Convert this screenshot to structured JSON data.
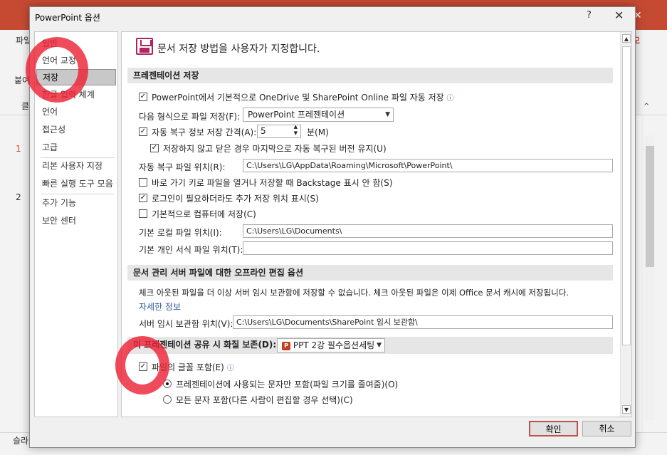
{
  "background": {
    "ribbon_tab": "파일",
    "paste_label": "붙여",
    "clipboard_label": "클",
    "auto_label": "자동",
    "slide_1": "1",
    "slide_2": "2",
    "status_text": "슬라",
    "corner_tab": "모",
    "close_glyph": "✕"
  },
  "dialog": {
    "title": "PowerPoint 옵션",
    "help": "?",
    "close": "✕",
    "nav_items": [
      "일반",
      "언어 교정",
      "저장",
      "한글 입력 체계",
      "언어",
      "접근성",
      "고급",
      "리본 사용자 지정",
      "빠른 실행 도구 모음",
      "추가 기능",
      "보안 센터"
    ],
    "selected_nav": "저장",
    "header": "문서 저장 방법을 사용자가 지정합니다.",
    "sections": {
      "presentation_save": {
        "title": "프레젠테이션 저장",
        "autosave_cloud": "PowerPoint에서 기본적으로 OneDrive 및 SharePoint Online 파일 자동 저장",
        "save_format_label": "다음 형식으로 파일 저장(F):",
        "save_format_value": "PowerPoint 프레젠테이션",
        "autorecover_label": "자동 복구 정보 저장 간격(A):",
        "autorecover_value": "5",
        "autorecover_unit": "분(M)",
        "keep_last": "저장하지 않고 닫은 경우 마지막으로 자동 복구된 버전 유지(U)",
        "autorecover_location_label": "자동 복구 파일 위치(R):",
        "autorecover_location_value": "C:\\Users\\LG\\AppData\\Roaming\\Microsoft\\PowerPoint\\",
        "backstage": "바로 가기 키로 파일을 열거나 저장할 때 Backstage 표시 안 함(S)",
        "show_additional": "로그인이 필요하더라도 추가 저장 위치 표시(S)",
        "save_to_computer": "기본적으로 컴퓨터에 저장(C)",
        "local_location_label": "기본 로컬 파일 위치(I):",
        "local_location_value": "C:\\Users\\LG\\Documents\\",
        "template_location_label": "기본 개인 서식 파일 위치(T):",
        "template_location_value": ""
      },
      "offline": {
        "title": "문서 관리 서버 파일에 대한 오프라인 편집 옵션",
        "description": "체크 아웃된 파일을 더 이상 서버 임시 보관함에 저장할 수 없습니다. 체크 아웃된 파일은 이제 Office 문서 캐시에 저장됩니다.",
        "more_info": "자세한 정보",
        "drafts_label": "서버 임시 보관함 위치(V):",
        "drafts_value": "C:\\Users\\LG\\Documents\\SharePoint 임시 보관함\\"
      },
      "fidelity": {
        "title": "이 프레젠테이션 공유 시 화질 보존(D):",
        "file_value": "PPT 2강 필수옵션세팅",
        "embed_fonts": "파일의 글꼴 포함(E)",
        "embed_used": "프레젠테이션에 사용되는 문자만 포함(파일 크기를 줄여줌)(O)",
        "embed_all": "모든 문자 포함(다른 사람이 편집할 경우 선택)(C)"
      }
    },
    "checkbox_states": {
      "autosave_cloud": true,
      "autorecover": true,
      "keep_last": true,
      "backstage": false,
      "show_additional": true,
      "save_to_computer": false,
      "embed_fonts": true
    },
    "check_glyph": "✓",
    "ok": "확인",
    "cancel": "취소"
  },
  "colors": {
    "accent_red": "#c64a32",
    "annotation_ring": "#eb2337",
    "icon_magenta": "#b0245f"
  },
  "icons": [
    "save-icon",
    "info-icon",
    "pptx-file-icon",
    "chevron-down-icon",
    "close-icon",
    "help-icon"
  ]
}
